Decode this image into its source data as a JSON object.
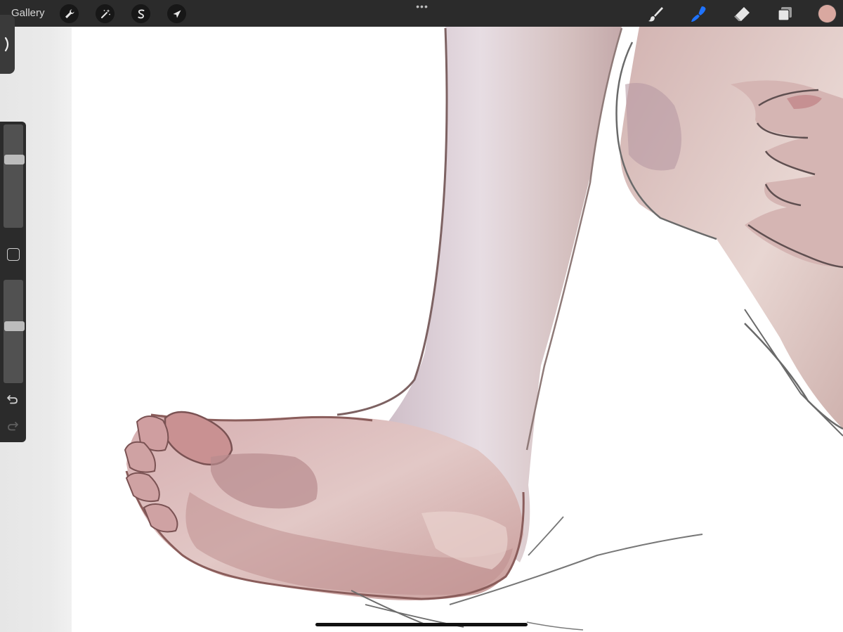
{
  "app": {
    "gallery_label": "Gallery"
  },
  "topbar": {
    "left_tools": [
      {
        "name": "actions",
        "icon": "wrench-icon"
      },
      {
        "name": "adjustments",
        "icon": "magic-wand-icon"
      },
      {
        "name": "selection",
        "icon": "selection-s-icon"
      },
      {
        "name": "transform",
        "icon": "arrow-cursor-icon"
      }
    ],
    "more_label": "•••",
    "right_tools": [
      {
        "name": "brush",
        "icon": "brush-icon",
        "active": false
      },
      {
        "name": "smudge",
        "icon": "smudge-icon",
        "active": true
      },
      {
        "name": "eraser",
        "icon": "eraser-icon",
        "active": false
      },
      {
        "name": "layers",
        "icon": "layers-icon",
        "active": false
      }
    ]
  },
  "colors": {
    "toolbar_bg": "#2b2b2b",
    "active_tool": "#1f73ff",
    "icon": "#e6e6e6",
    "current_color": "#d9a8a0"
  },
  "sidebar": {
    "toggle_icon": "chevron-right-icon",
    "brush_size_level": 0.68,
    "brush_opacity_level": 0.56,
    "modify_icon": "square-icon",
    "undo_icon": "undo-icon",
    "redo_icon": "redo-icon"
  }
}
